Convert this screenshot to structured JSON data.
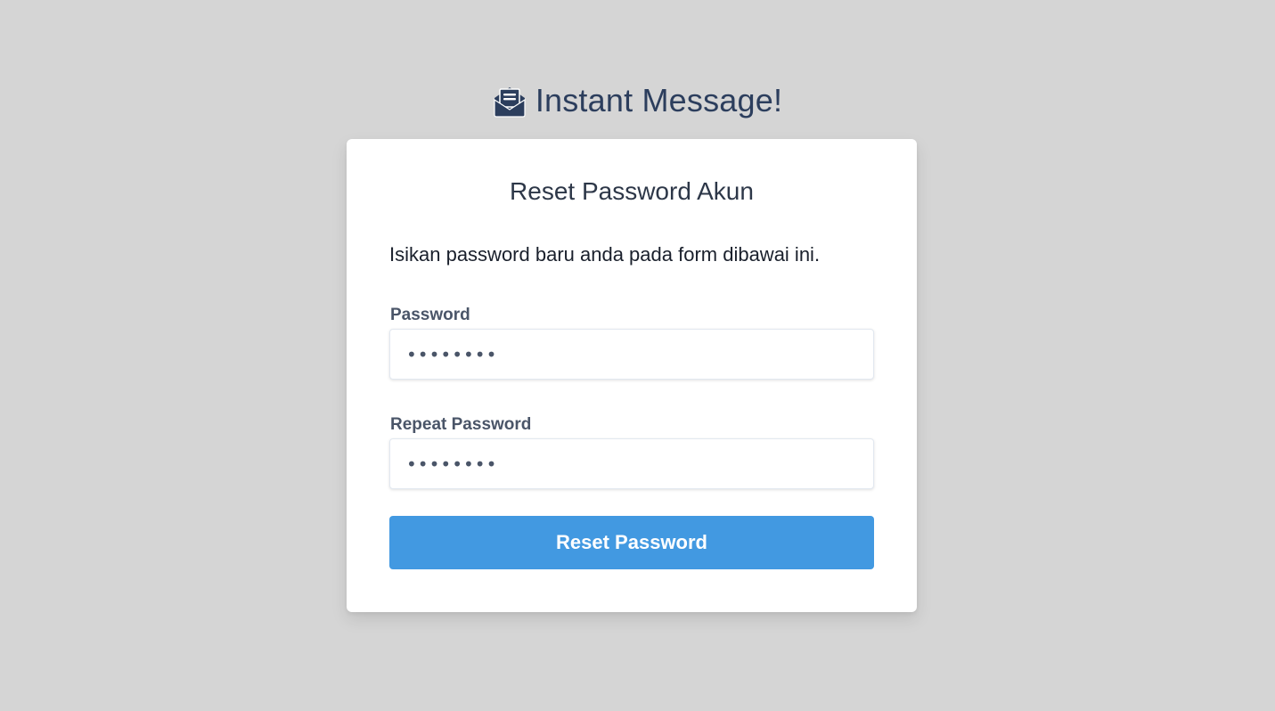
{
  "brand": {
    "title": "Instant Message!",
    "icon": "envelope-open-text-icon",
    "color": "#2c3e5d"
  },
  "card": {
    "title": "Reset Password Akun",
    "description": "Isikan password baru anda pada form dibawai ini."
  },
  "form": {
    "password": {
      "label": "Password",
      "value": "12345678"
    },
    "repeat_password": {
      "label": "Repeat Password",
      "value": "12345678"
    },
    "submit_label": "Reset Password"
  },
  "colors": {
    "background": "#d5d5d5",
    "button": "#4299e1",
    "card": "#ffffff"
  }
}
